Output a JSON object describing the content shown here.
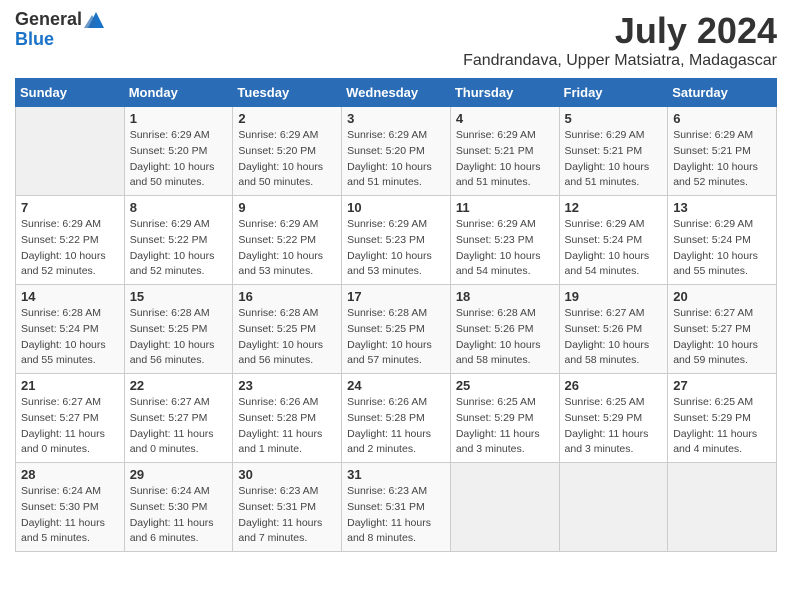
{
  "header": {
    "logo_line1": "General",
    "logo_line2": "Blue",
    "main_title": "July 2024",
    "subtitle": "Fandrandava, Upper Matsiatra, Madagascar"
  },
  "calendar": {
    "days_of_week": [
      "Sunday",
      "Monday",
      "Tuesday",
      "Wednesday",
      "Thursday",
      "Friday",
      "Saturday"
    ],
    "weeks": [
      [
        {
          "day": "",
          "info": ""
        },
        {
          "day": "1",
          "info": "Sunrise: 6:29 AM\nSunset: 5:20 PM\nDaylight: 10 hours\nand 50 minutes."
        },
        {
          "day": "2",
          "info": "Sunrise: 6:29 AM\nSunset: 5:20 PM\nDaylight: 10 hours\nand 50 minutes."
        },
        {
          "day": "3",
          "info": "Sunrise: 6:29 AM\nSunset: 5:20 PM\nDaylight: 10 hours\nand 51 minutes."
        },
        {
          "day": "4",
          "info": "Sunrise: 6:29 AM\nSunset: 5:21 PM\nDaylight: 10 hours\nand 51 minutes."
        },
        {
          "day": "5",
          "info": "Sunrise: 6:29 AM\nSunset: 5:21 PM\nDaylight: 10 hours\nand 51 minutes."
        },
        {
          "day": "6",
          "info": "Sunrise: 6:29 AM\nSunset: 5:21 PM\nDaylight: 10 hours\nand 52 minutes."
        }
      ],
      [
        {
          "day": "7",
          "info": "Sunrise: 6:29 AM\nSunset: 5:22 PM\nDaylight: 10 hours\nand 52 minutes."
        },
        {
          "day": "8",
          "info": "Sunrise: 6:29 AM\nSunset: 5:22 PM\nDaylight: 10 hours\nand 52 minutes."
        },
        {
          "day": "9",
          "info": "Sunrise: 6:29 AM\nSunset: 5:22 PM\nDaylight: 10 hours\nand 53 minutes."
        },
        {
          "day": "10",
          "info": "Sunrise: 6:29 AM\nSunset: 5:23 PM\nDaylight: 10 hours\nand 53 minutes."
        },
        {
          "day": "11",
          "info": "Sunrise: 6:29 AM\nSunset: 5:23 PM\nDaylight: 10 hours\nand 54 minutes."
        },
        {
          "day": "12",
          "info": "Sunrise: 6:29 AM\nSunset: 5:24 PM\nDaylight: 10 hours\nand 54 minutes."
        },
        {
          "day": "13",
          "info": "Sunrise: 6:29 AM\nSunset: 5:24 PM\nDaylight: 10 hours\nand 55 minutes."
        }
      ],
      [
        {
          "day": "14",
          "info": "Sunrise: 6:28 AM\nSunset: 5:24 PM\nDaylight: 10 hours\nand 55 minutes."
        },
        {
          "day": "15",
          "info": "Sunrise: 6:28 AM\nSunset: 5:25 PM\nDaylight: 10 hours\nand 56 minutes."
        },
        {
          "day": "16",
          "info": "Sunrise: 6:28 AM\nSunset: 5:25 PM\nDaylight: 10 hours\nand 56 minutes."
        },
        {
          "day": "17",
          "info": "Sunrise: 6:28 AM\nSunset: 5:25 PM\nDaylight: 10 hours\nand 57 minutes."
        },
        {
          "day": "18",
          "info": "Sunrise: 6:28 AM\nSunset: 5:26 PM\nDaylight: 10 hours\nand 58 minutes."
        },
        {
          "day": "19",
          "info": "Sunrise: 6:27 AM\nSunset: 5:26 PM\nDaylight: 10 hours\nand 58 minutes."
        },
        {
          "day": "20",
          "info": "Sunrise: 6:27 AM\nSunset: 5:27 PM\nDaylight: 10 hours\nand 59 minutes."
        }
      ],
      [
        {
          "day": "21",
          "info": "Sunrise: 6:27 AM\nSunset: 5:27 PM\nDaylight: 11 hours\nand 0 minutes."
        },
        {
          "day": "22",
          "info": "Sunrise: 6:27 AM\nSunset: 5:27 PM\nDaylight: 11 hours\nand 0 minutes."
        },
        {
          "day": "23",
          "info": "Sunrise: 6:26 AM\nSunset: 5:28 PM\nDaylight: 11 hours\nand 1 minute."
        },
        {
          "day": "24",
          "info": "Sunrise: 6:26 AM\nSunset: 5:28 PM\nDaylight: 11 hours\nand 2 minutes."
        },
        {
          "day": "25",
          "info": "Sunrise: 6:25 AM\nSunset: 5:29 PM\nDaylight: 11 hours\nand 3 minutes."
        },
        {
          "day": "26",
          "info": "Sunrise: 6:25 AM\nSunset: 5:29 PM\nDaylight: 11 hours\nand 3 minutes."
        },
        {
          "day": "27",
          "info": "Sunrise: 6:25 AM\nSunset: 5:29 PM\nDaylight: 11 hours\nand 4 minutes."
        }
      ],
      [
        {
          "day": "28",
          "info": "Sunrise: 6:24 AM\nSunset: 5:30 PM\nDaylight: 11 hours\nand 5 minutes."
        },
        {
          "day": "29",
          "info": "Sunrise: 6:24 AM\nSunset: 5:30 PM\nDaylight: 11 hours\nand 6 minutes."
        },
        {
          "day": "30",
          "info": "Sunrise: 6:23 AM\nSunset: 5:31 PM\nDaylight: 11 hours\nand 7 minutes."
        },
        {
          "day": "31",
          "info": "Sunrise: 6:23 AM\nSunset: 5:31 PM\nDaylight: 11 hours\nand 8 minutes."
        },
        {
          "day": "",
          "info": ""
        },
        {
          "day": "",
          "info": ""
        },
        {
          "day": "",
          "info": ""
        }
      ]
    ]
  }
}
